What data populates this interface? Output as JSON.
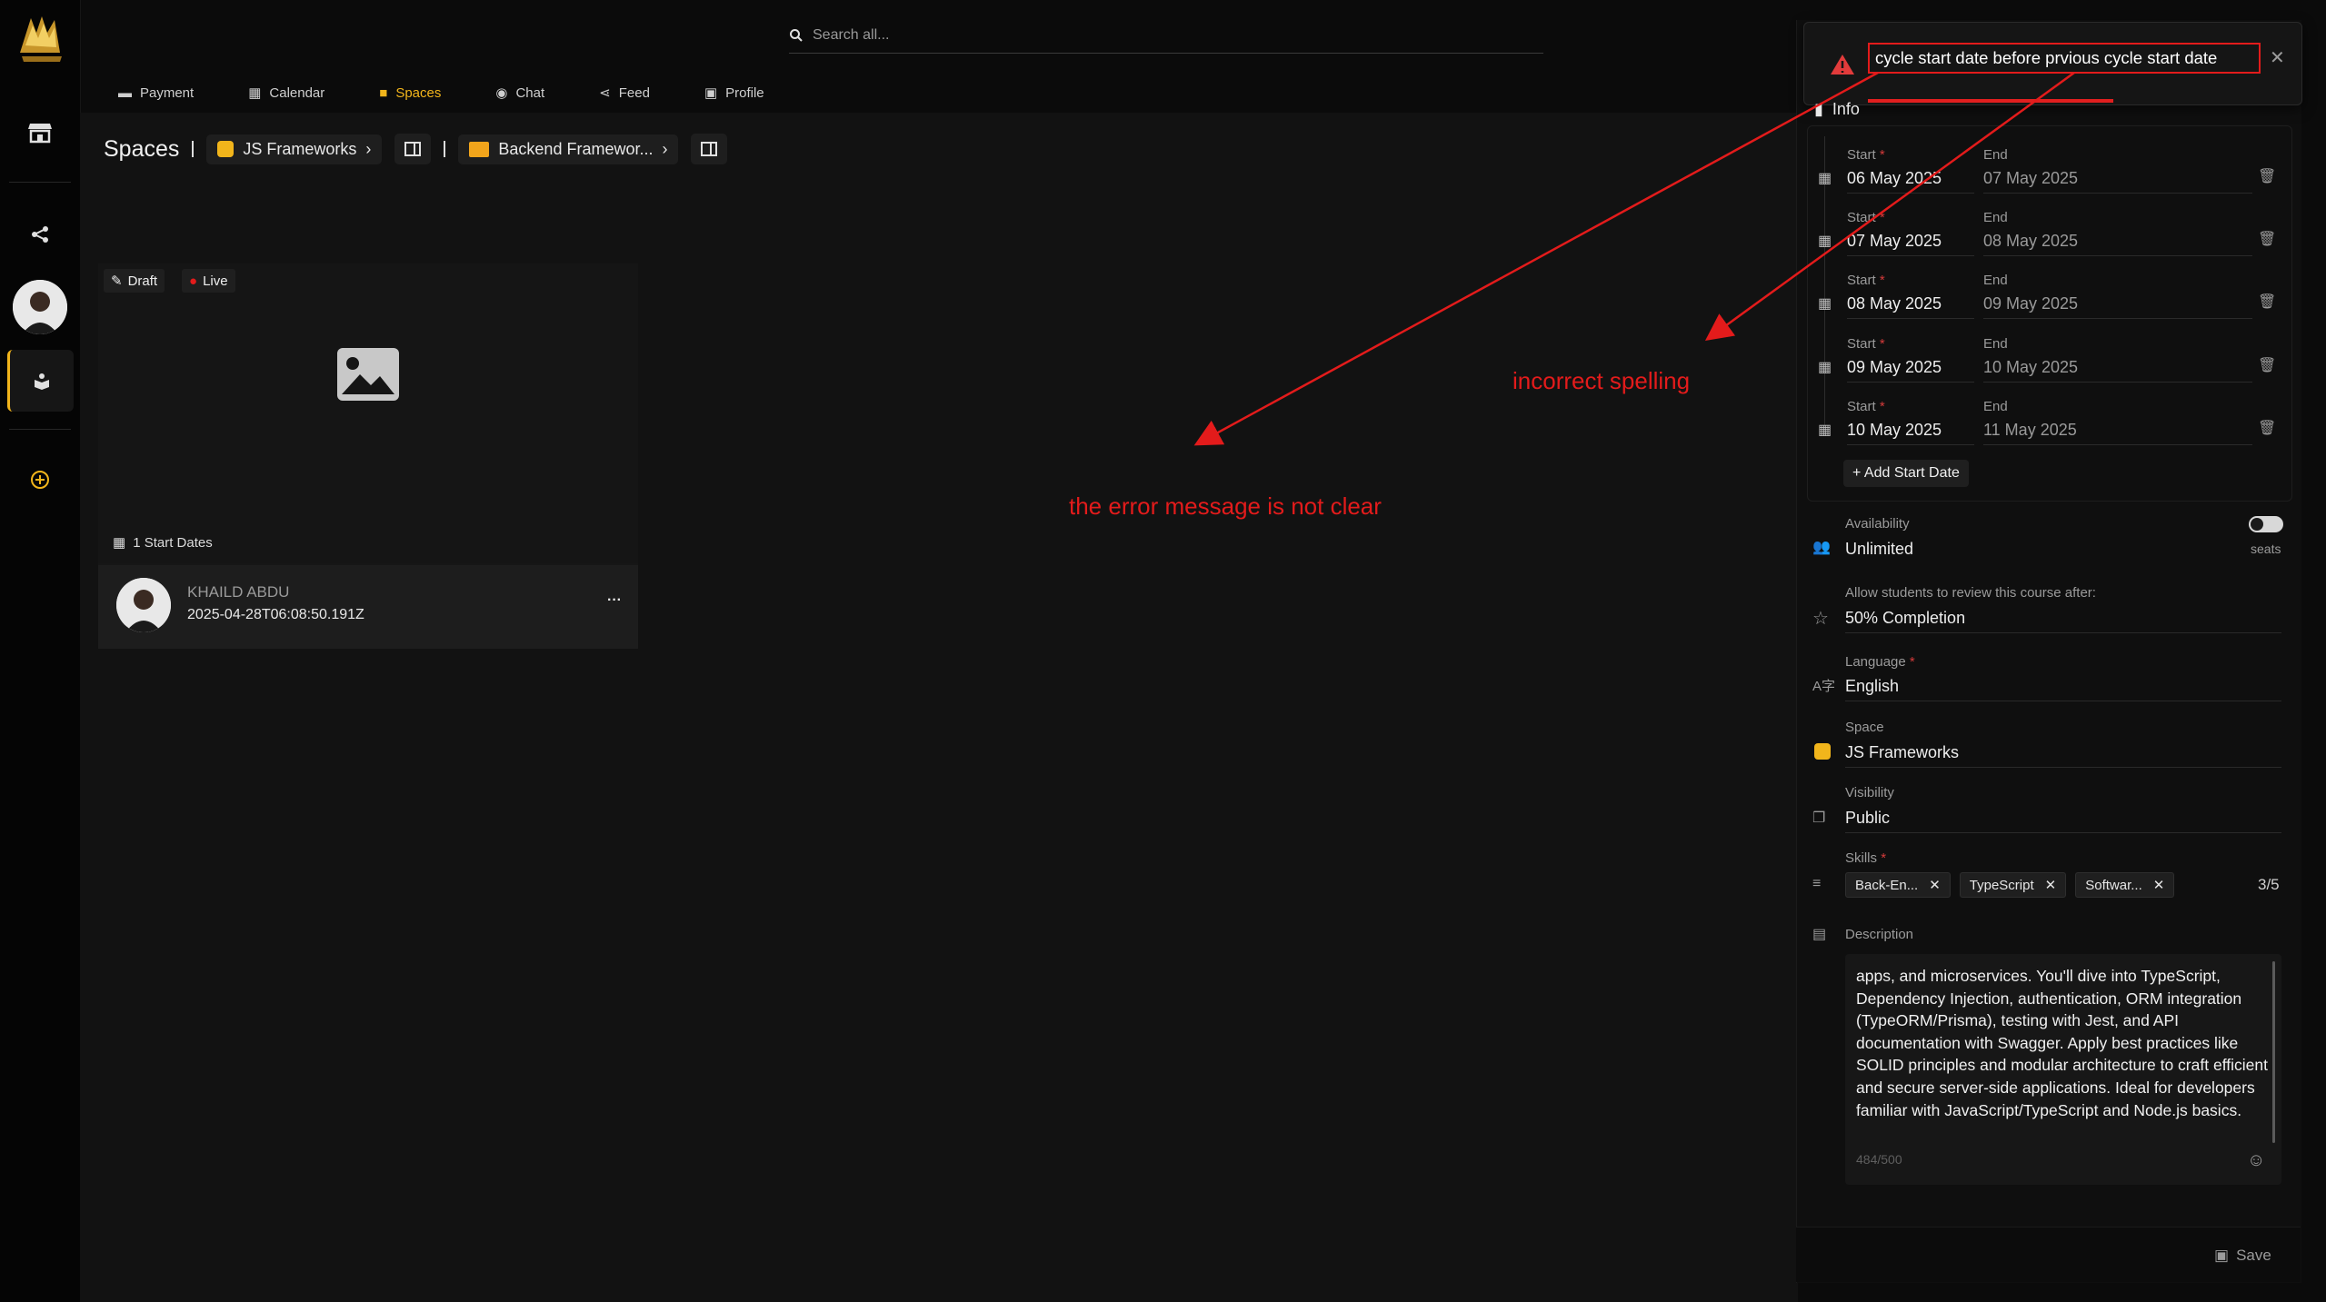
{
  "search": {
    "placeholder": "Search all..."
  },
  "tabs": [
    {
      "label": "Payment",
      "icon": "card-icon"
    },
    {
      "label": "Calendar",
      "icon": "calendar-icon"
    },
    {
      "label": "Spaces",
      "icon": "folder-icon",
      "active": true
    },
    {
      "label": "Chat",
      "icon": "chat-icon"
    },
    {
      "label": "Feed",
      "icon": "share-icon"
    },
    {
      "label": "Profile",
      "icon": "id-card-icon"
    }
  ],
  "breadcrumb": {
    "title": "Spaces",
    "space": "JS Frameworks",
    "folder": "Backend Framewor..."
  },
  "card": {
    "badge_draft": "Draft",
    "badge_live": "Live",
    "start_dates": "1 Start Dates",
    "author": "KHAILD ABDU",
    "timestamp": "2025-04-28T06:08:50.191Z",
    "more": "···"
  },
  "toast": {
    "message": "cycle start date before prvious cycle start date",
    "close": "✕"
  },
  "panel": {
    "section_title": "Info",
    "start_label": "Start",
    "end_label": "End",
    "dates": [
      {
        "start": "06 May 2025",
        "end": "07 May 2025"
      },
      {
        "start": "07 May 2025",
        "end": "08 May 2025"
      },
      {
        "start": "08 May 2025",
        "end": "09 May 2025"
      },
      {
        "start": "09 May 2025",
        "end": "10 May 2025"
      },
      {
        "start": "10 May 2025",
        "end": "11 May 2025"
      }
    ],
    "add_start_date": "+ Add Start Date",
    "availability_label": "Availability",
    "availability_value": "Unlimited",
    "seats_label": "seats",
    "review_label": "Allow students to review this course after:",
    "review_value": "50% Completion",
    "language_label": "Language",
    "language_value": "English",
    "space_label": "Space",
    "space_value": "JS Frameworks",
    "visibility_label": "Visibility",
    "visibility_value": "Public",
    "skills_label": "Skills",
    "skills": [
      "Back-En...",
      "TypeScript",
      "Softwar..."
    ],
    "skills_count": "3/5",
    "description_label": "Description",
    "description_text": "apps, and microservices. You'll dive into TypeScript, Dependency Injection, authentication, ORM integration (TypeORM/Prisma), testing with Jest, and API documentation with Swagger. Apply best practices like SOLID principles and modular architecture to craft efficient and secure server-side applications. Ideal for developers familiar with JavaScript/TypeScript and Node.js basics.",
    "char_count": "484/500",
    "save_label": "Save"
  },
  "annotations": {
    "spelling": "incorrect spelling",
    "unclear": "the error message is not clear"
  },
  "colors": {
    "accent": "#f2b51b",
    "error": "#e31b1b",
    "background": "#0b0b0b",
    "panel": "#0f0f0f"
  }
}
